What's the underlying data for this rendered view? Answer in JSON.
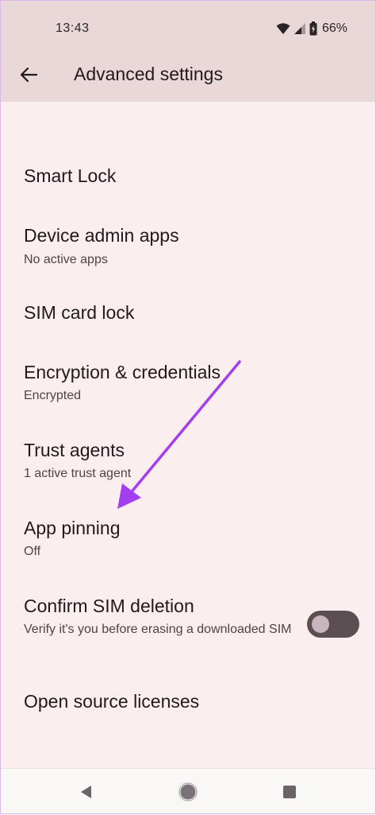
{
  "status_bar": {
    "time": "13:43",
    "battery_text": "66%",
    "icons": [
      "wifi-icon",
      "cell-signal-icon",
      "battery-charging-icon"
    ]
  },
  "app_bar": {
    "back_icon": "arrow-back-icon",
    "title": "Advanced settings"
  },
  "settings": {
    "items": [
      {
        "title": "Smart Lock",
        "summary": ""
      },
      {
        "title": "Device admin apps",
        "summary": "No active apps"
      },
      {
        "title": "SIM card lock",
        "summary": ""
      },
      {
        "title": "Encryption & credentials",
        "summary": "Encrypted"
      },
      {
        "title": "Trust agents",
        "summary": "1 active trust agent"
      },
      {
        "title": "App pinning",
        "summary": "Off"
      },
      {
        "title": "Confirm SIM deletion",
        "summary": "Verify it's you before erasing a downloaded SIM",
        "toggle_on": false
      },
      {
        "title": "Open source licenses",
        "summary": ""
      }
    ]
  },
  "annotation": {
    "color": "#a33ff0",
    "points_to": "App pinning"
  },
  "nav_bar": {
    "icons": [
      "nav-back-triangle-icon",
      "nav-home-circle-icon",
      "nav-recents-square-icon"
    ]
  },
  "colors": {
    "background": "#faeeee",
    "app_bar": "#ead8d8",
    "toggle_track_off": "#5c4f54",
    "toggle_thumb_off": "#c7b7bc"
  }
}
